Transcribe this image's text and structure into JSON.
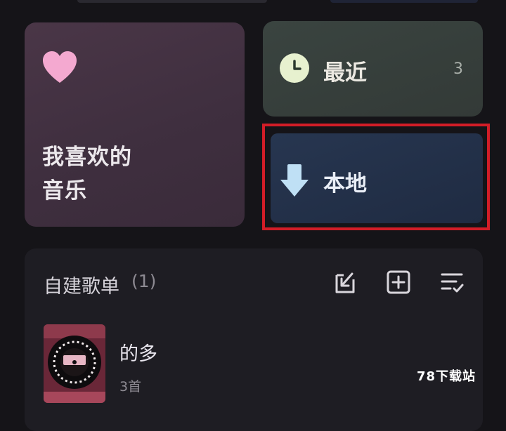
{
  "favorite": {
    "title_line1": "我喜欢的",
    "title_line2": "音乐",
    "icon": "heart-icon",
    "accent": "#f2a6cf"
  },
  "recent": {
    "label": "最近",
    "count": "3",
    "icon": "clock-icon"
  },
  "local": {
    "label": "本地",
    "icon": "download-arrow-icon",
    "highlight_color": "#d21d27"
  },
  "playlists": {
    "title": "自建歌单",
    "count": "(1)",
    "tools": [
      "import-icon",
      "add-playlist-icon",
      "manage-list-icon"
    ],
    "items": [
      {
        "name": "的多",
        "subtitle": "3首"
      }
    ]
  },
  "watermark": "78下载站"
}
